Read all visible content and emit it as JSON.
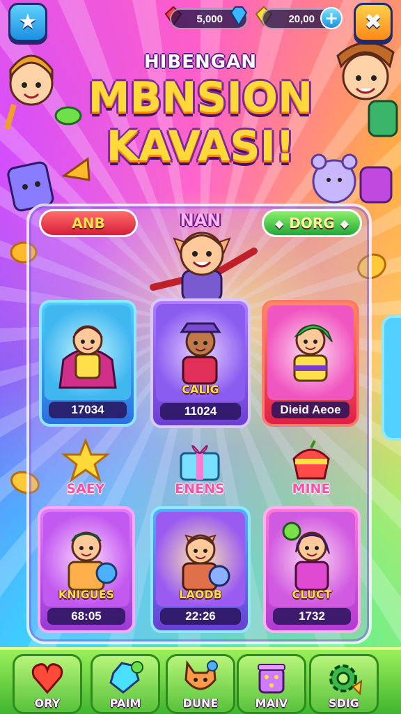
{
  "header": {
    "resource_1": "5,000",
    "resource_2": "20,00",
    "left_button_icon": "star-icon",
    "right_button_icon": "puzzle-icon",
    "plus_label": "+"
  },
  "title": {
    "pre": "HIBENGAN",
    "line1": "MBNSION",
    "line2": "KAVASI!"
  },
  "panel": {
    "left_button": "ANB",
    "right_button": "DORG",
    "hero_name": "NAN"
  },
  "cards": [
    {
      "name": "",
      "value": "17034"
    },
    {
      "name": "CALIG",
      "value": "11024"
    },
    {
      "name": "Dieid Aeoe",
      "value": ""
    },
    {
      "name": "KNIGUES",
      "value": "68:05"
    },
    {
      "name": "LAODB",
      "value": "22:26"
    },
    {
      "name": "CLUCT",
      "value": "1732"
    }
  ],
  "items": [
    {
      "label": "SAEY",
      "icon": "star-icon"
    },
    {
      "label": "ENENS",
      "icon": "gift-icon"
    },
    {
      "label": "MINE",
      "icon": "fruit-icon"
    }
  ],
  "nav": [
    {
      "label": "ORY",
      "icon": "heart-icon"
    },
    {
      "label": "PAIM",
      "icon": "gem-icon"
    },
    {
      "label": "DUNE",
      "icon": "cat-face-icon"
    },
    {
      "label": "MAIV",
      "icon": "basket-icon"
    },
    {
      "label": "SDIG",
      "icon": "gear-icon"
    }
  ],
  "colors": {
    "title": "#ffd93a",
    "title_outline": "#7a2a9a",
    "nav_bg": "#58c23a",
    "pill_red": "#d61e3a",
    "pill_green": "#22a93a"
  }
}
